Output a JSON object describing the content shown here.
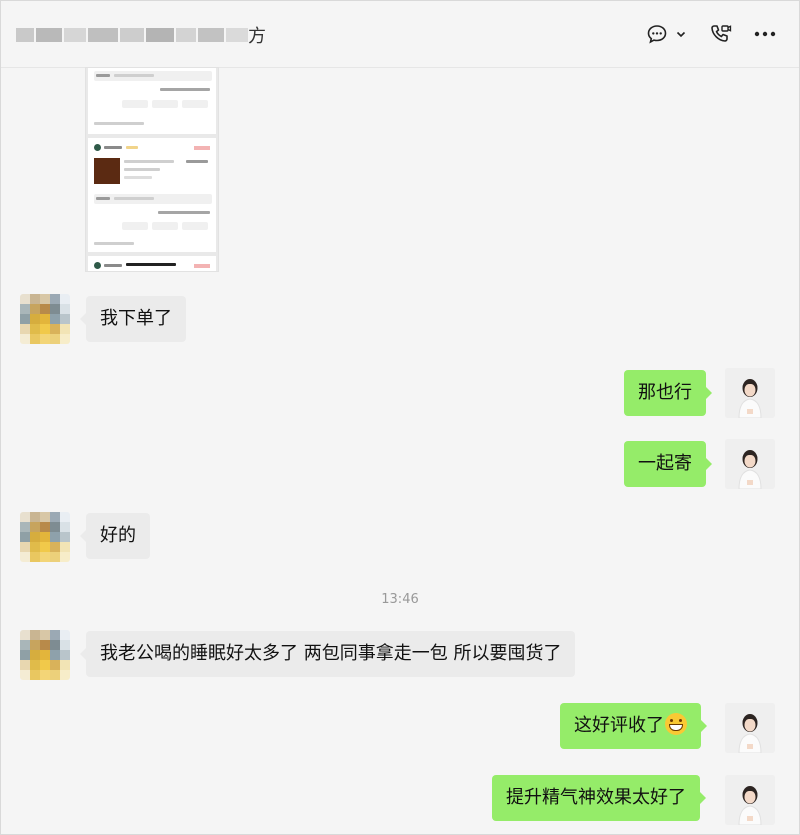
{
  "header": {
    "title_tail": "方",
    "icons": {
      "chat": "chat-bubble-icon",
      "dropdown": "chevron-down-icon",
      "call": "phone-video-icon",
      "more": "more-dots-icon"
    }
  },
  "messages": [
    {
      "side": "in",
      "type": "image",
      "content": "order-screenshot"
    },
    {
      "side": "in",
      "text": "我下单了"
    },
    {
      "side": "out",
      "text": "那也行"
    },
    {
      "side": "out",
      "text": "一起寄"
    },
    {
      "side": "in",
      "text": "好的"
    },
    {
      "time": "13:46"
    },
    {
      "side": "in",
      "text": "我老公喝的睡眠好太多了 两包同事拿走一包 所以要囤货了"
    },
    {
      "side": "out",
      "text": "这好评收了",
      "emoji": "grinning-face-emoji"
    },
    {
      "side": "out",
      "text": "提升精气神效果太好了"
    }
  ],
  "colors": {
    "bubble_out": "#95ec69",
    "bubble_in": "#ebebeb",
    "background": "#f5f5f5"
  }
}
